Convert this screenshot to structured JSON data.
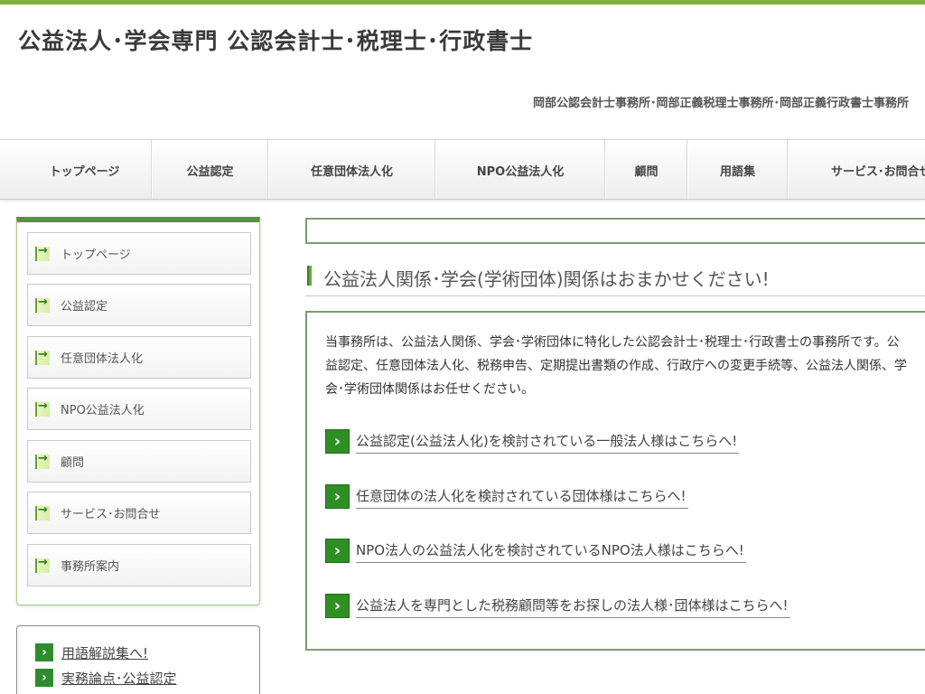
{
  "site": {
    "title": "公益法人･学会専門  公認会計士･税理士･行政書士",
    "subtitle": "岡部公認会計士事務所･岡部正義税理士事務所･岡部正義行政書士事務所"
  },
  "global_nav": [
    {
      "label": "トップページ"
    },
    {
      "label": "公益認定"
    },
    {
      "label": "任意団体法人化"
    },
    {
      "label": "NPO公益法人化"
    },
    {
      "label": "顧問"
    },
    {
      "label": "用語集"
    },
    {
      "label": "サービス･お問合せ"
    }
  ],
  "side_menu": [
    {
      "label": "トップページ"
    },
    {
      "label": "公益認定"
    },
    {
      "label": "任意団体法人化"
    },
    {
      "label": "NPO公益法人化"
    },
    {
      "label": "顧問"
    },
    {
      "label": "サービス･お問合せ"
    },
    {
      "label": "事務所案内"
    }
  ],
  "side_links": [
    {
      "label": "用語解説集へ!"
    },
    {
      "label": "実務論点･公益認定"
    }
  ],
  "main": {
    "heading": "公益法人関係･学会(学術団体)関係はおまかせください!",
    "intro_lines": [
      "当事務所は、公益法人関係、学会･学術団体に特化した公認会計士･税理士･行政書士の事務所です。公",
      "益認定、任意団体法人化、税務申告、定期提出書類の作成、行政庁への変更手続等、公益法人関係、学",
      "会･学術団体関係はお任せください。"
    ],
    "cta_links": [
      {
        "label": "公益認定(公益法人化)を検討されている一般法人様はこちらへ!"
      },
      {
        "label": "任意団体の法人化を検討されている団体様はこちらへ!"
      },
      {
        "label": "NPO法人の公益法人化を検討されているNPO法人様はこちらへ!"
      },
      {
        "label": "公益法人を専門とした税務顧問等をお探しの法人様･団体様はこちらへ!"
      }
    ]
  },
  "icons": {
    "nav_arrow": "arrow-right-icon",
    "cta_chevron": "chevron-right-icon"
  },
  "colors": {
    "accent_green": "#4c9a33",
    "top_bar": "#7cae3e",
    "box_border": "#7d9a76"
  }
}
